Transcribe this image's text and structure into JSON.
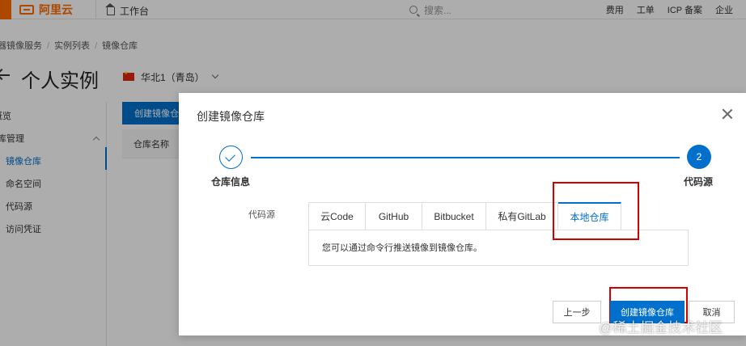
{
  "topbar": {
    "brand": "阿里云",
    "home": "工作台",
    "search_placeholder": "搜索...",
    "nav": [
      "费用",
      "工单",
      "ICP 备案",
      "企业"
    ]
  },
  "breadcrumb": [
    "容器镜像服务",
    "实例列表",
    "镜像仓库"
  ],
  "page": {
    "title": "个人实例",
    "region": "华北1（青岛）"
  },
  "sidebar": {
    "items": [
      "概览",
      "仓库管理",
      "镜像仓库",
      "命名空间",
      "代码源",
      "访问凭证"
    ]
  },
  "background": {
    "create_button": "创建镜像仓库",
    "column_header": "仓库名称"
  },
  "modal": {
    "title": "创建镜像仓库",
    "steps": [
      {
        "label": "仓库信息",
        "state": "done"
      },
      {
        "label": "代码源",
        "number": "2",
        "state": "active"
      }
    ],
    "field_label": "代码源",
    "tabs": [
      "云Code",
      "GitHub",
      "Bitbucket",
      "私有GitLab",
      "本地仓库"
    ],
    "active_tab": "本地仓库",
    "panel_text": "您可以通过命令行推送镜像到镜像仓库。",
    "buttons": {
      "prev": "上一步",
      "create": "创建镜像仓库",
      "cancel": "取消"
    }
  },
  "watermark": "@稀土掘金技术社区",
  "colors": {
    "primary": "#0070cc",
    "brand": "#ff6a00",
    "highlight": "#d40000"
  }
}
